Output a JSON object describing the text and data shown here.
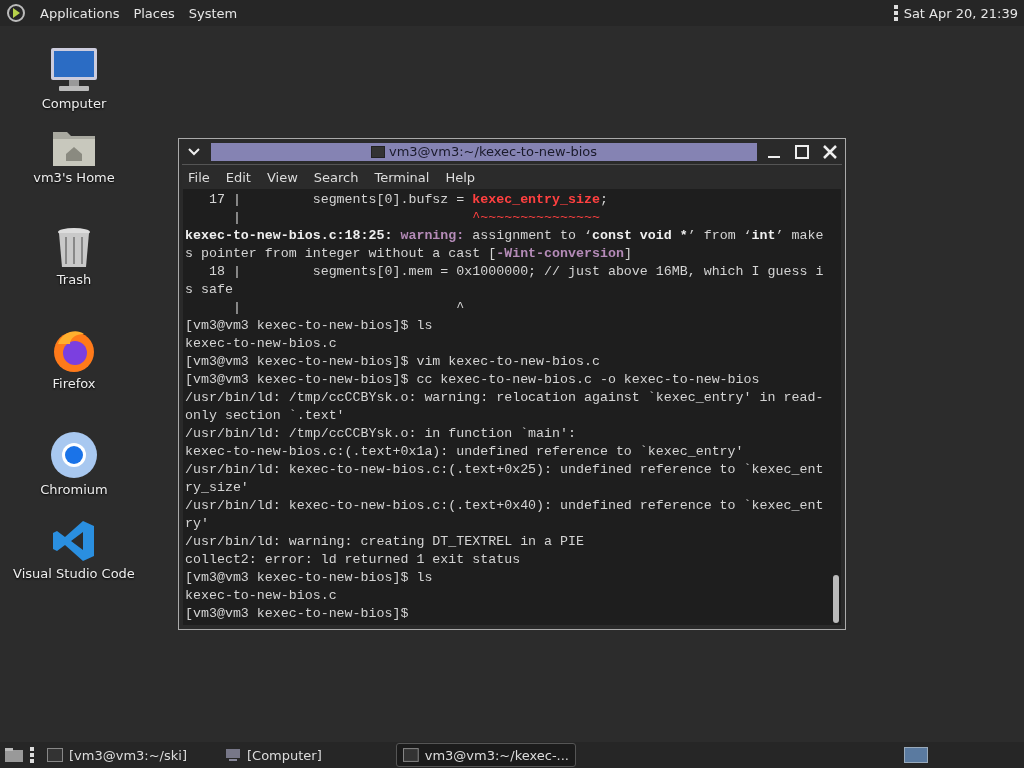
{
  "top_panel": {
    "menus": [
      "Applications",
      "Places",
      "System"
    ],
    "clock": "Sat Apr 20, 21:39"
  },
  "desktop_icons": [
    {
      "label": "Computer",
      "kind": "computer"
    },
    {
      "label": "vm3's Home",
      "kind": "home"
    },
    {
      "label": "Trash",
      "kind": "trash"
    },
    {
      "label": "Firefox",
      "kind": "firefox"
    },
    {
      "label": "Chromium",
      "kind": "chromium"
    },
    {
      "label": "Visual Studio Code",
      "kind": "vscode"
    }
  ],
  "window": {
    "title": "vm3@vm3:~/kexec-to-new-bios",
    "menu": [
      "File",
      "Edit",
      "View",
      "Search",
      "Terminal",
      "Help"
    ],
    "lines": [
      [
        {
          "text": "   17 |         segments[0].bufsz = ",
          "kind": "plain"
        },
        {
          "text": "kexec_entry_size",
          "kind": "error"
        },
        {
          "text": ";",
          "kind": "plain"
        }
      ],
      [
        {
          "text": "      |                             ",
          "kind": "plain"
        },
        {
          "text": "^~~~~~~~~~~~~~~~",
          "kind": "caret"
        }
      ],
      [
        {
          "text": "kexec-to-new-bios.c:18:25: ",
          "kind": "bold"
        },
        {
          "text": "warning:",
          "kind": "warning"
        },
        {
          "text": " assignment to ‘",
          "kind": "plain"
        },
        {
          "text": "const void *",
          "kind": "bold"
        },
        {
          "text": "’ from ‘",
          "kind": "plain"
        },
        {
          "text": "int",
          "kind": "bold"
        },
        {
          "text": "’ make",
          "kind": "plain"
        }
      ],
      [
        {
          "text": "s pointer from integer without a cast [",
          "kind": "plain"
        },
        {
          "text": "-Wint-conversion",
          "kind": "warning"
        },
        {
          "text": "]",
          "kind": "plain"
        }
      ],
      [
        {
          "text": "   18 |         segments[0].mem = 0x1000000; // just above 16MB, which I guess i",
          "kind": "plain"
        }
      ],
      [
        {
          "text": "s safe",
          "kind": "plain"
        }
      ],
      [
        {
          "text": "      |                           ^",
          "kind": "plain"
        }
      ],
      [
        {
          "text": "[vm3@vm3 kexec-to-new-bios]$ ls",
          "kind": "plain"
        }
      ],
      [
        {
          "text": "kexec-to-new-bios.c",
          "kind": "plain"
        }
      ],
      [
        {
          "text": "[vm3@vm3 kexec-to-new-bios]$ vim kexec-to-new-bios.c",
          "kind": "plain"
        }
      ],
      [
        {
          "text": "[vm3@vm3 kexec-to-new-bios]$ cc kexec-to-new-bios.c -o kexec-to-new-bios",
          "kind": "plain"
        }
      ],
      [
        {
          "text": "/usr/bin/ld: /tmp/ccCCBYsk.o: warning: relocation against `kexec_entry' in read-",
          "kind": "plain"
        }
      ],
      [
        {
          "text": "only section `.text'",
          "kind": "plain"
        }
      ],
      [
        {
          "text": "/usr/bin/ld: /tmp/ccCCBYsk.o: in function `main':",
          "kind": "plain"
        }
      ],
      [
        {
          "text": "kexec-to-new-bios.c:(.text+0x1a): undefined reference to `kexec_entry'",
          "kind": "plain"
        }
      ],
      [
        {
          "text": "/usr/bin/ld: kexec-to-new-bios.c:(.text+0x25): undefined reference to `kexec_ent",
          "kind": "plain"
        }
      ],
      [
        {
          "text": "ry_size'",
          "kind": "plain"
        }
      ],
      [
        {
          "text": "/usr/bin/ld: kexec-to-new-bios.c:(.text+0x40): undefined reference to `kexec_ent",
          "kind": "plain"
        }
      ],
      [
        {
          "text": "ry'",
          "kind": "plain"
        }
      ],
      [
        {
          "text": "/usr/bin/ld: warning: creating DT_TEXTREL in a PIE",
          "kind": "plain"
        }
      ],
      [
        {
          "text": "collect2: error: ld returned 1 exit status",
          "kind": "plain"
        }
      ],
      [
        {
          "text": "[vm3@vm3 kexec-to-new-bios]$ ls",
          "kind": "plain"
        }
      ],
      [
        {
          "text": "kexec-to-new-bios.c",
          "kind": "plain"
        }
      ],
      [
        {
          "text": "[vm3@vm3 kexec-to-new-bios]$",
          "kind": "plain"
        }
      ]
    ]
  },
  "taskbar": {
    "items": [
      {
        "label": "[vm3@vm3:~/ski]",
        "kind": "terminal",
        "selected": false
      },
      {
        "label": "[Computer]",
        "kind": "computer",
        "selected": false
      },
      {
        "label": "vm3@vm3:~/kexec-...",
        "kind": "terminal",
        "selected": true
      }
    ]
  }
}
